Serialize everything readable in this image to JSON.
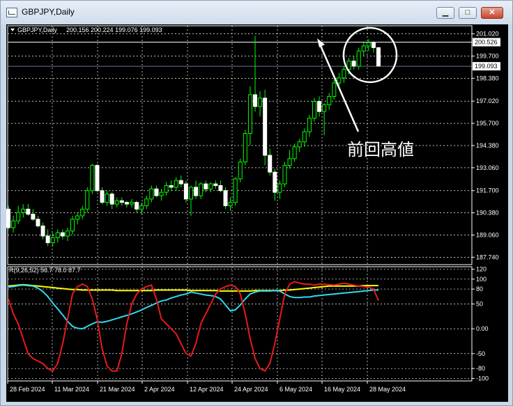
{
  "window": {
    "title": "GBPJPY,Daily",
    "minimize_label": "▁",
    "maximize_label": "□",
    "close_label": "✕"
  },
  "info_line": {
    "symbol": "GBPJPY,Daily",
    "ohlc": "200.156 200.224 199.076 199.093"
  },
  "annotation": "前回高値",
  "indicator_label": "R(9,26,52) 56.7 78.0 87.7",
  "chart_data": [
    {
      "type": "candlestick",
      "price_axis_labels": [
        "201.020",
        "199.700",
        "198.380",
        "197.020",
        "195.700",
        "194.380",
        "193.060",
        "191.700",
        "190.380",
        "189.060",
        "187.740"
      ],
      "current_price_label": "199.093",
      "marked_price_label": "200.526",
      "date_labels": [
        "28 Feb 2024",
        "11 Mar 2024",
        "21 Mar 2024",
        "2 Apr 2024",
        "12 Apr 2024",
        "24 Apr 2024",
        "6 May 2024",
        "16 May 2024",
        "28 May 2024"
      ],
      "ylim": [
        187.3,
        201.5
      ],
      "candles": [
        {
          "o": 190.6,
          "h": 190.8,
          "l": 189.4,
          "c": 189.5
        },
        {
          "o": 189.5,
          "h": 190.2,
          "l": 189.2,
          "c": 189.9
        },
        {
          "o": 189.9,
          "h": 190.8,
          "l": 189.7,
          "c": 190.4
        },
        {
          "o": 190.4,
          "h": 190.9,
          "l": 190.1,
          "c": 190.6
        },
        {
          "o": 190.6,
          "h": 190.9,
          "l": 190.2,
          "c": 190.3
        },
        {
          "o": 190.3,
          "h": 190.6,
          "l": 189.9,
          "c": 190.0
        },
        {
          "o": 190.0,
          "h": 190.2,
          "l": 189.5,
          "c": 189.6
        },
        {
          "o": 189.6,
          "h": 189.8,
          "l": 188.8,
          "c": 189.0
        },
        {
          "o": 189.0,
          "h": 189.4,
          "l": 188.4,
          "c": 188.6
        },
        {
          "o": 188.6,
          "h": 189.2,
          "l": 188.4,
          "c": 188.9
        },
        {
          "o": 188.9,
          "h": 189.4,
          "l": 188.6,
          "c": 189.2
        },
        {
          "o": 189.2,
          "h": 189.4,
          "l": 188.8,
          "c": 189.0
        },
        {
          "o": 189.0,
          "h": 189.5,
          "l": 188.7,
          "c": 189.3
        },
        {
          "o": 189.3,
          "h": 190.2,
          "l": 189.1,
          "c": 190.0
        },
        {
          "o": 190.0,
          "h": 190.4,
          "l": 189.7,
          "c": 190.2
        },
        {
          "o": 190.2,
          "h": 190.8,
          "l": 190.0,
          "c": 190.6
        },
        {
          "o": 190.6,
          "h": 191.9,
          "l": 190.4,
          "c": 191.7
        },
        {
          "o": 191.7,
          "h": 193.3,
          "l": 191.5,
          "c": 193.2
        },
        {
          "o": 193.2,
          "h": 193.3,
          "l": 191.6,
          "c": 191.7
        },
        {
          "o": 191.7,
          "h": 191.9,
          "l": 190.9,
          "c": 191.0
        },
        {
          "o": 191.0,
          "h": 191.7,
          "l": 190.8,
          "c": 191.5
        },
        {
          "o": 191.5,
          "h": 191.6,
          "l": 190.6,
          "c": 190.9
        },
        {
          "o": 190.9,
          "h": 191.3,
          "l": 190.7,
          "c": 191.1
        },
        {
          "o": 191.1,
          "h": 191.3,
          "l": 190.8,
          "c": 191.0
        },
        {
          "o": 191.0,
          "h": 191.1,
          "l": 190.7,
          "c": 190.9
        },
        {
          "o": 190.9,
          "h": 191.2,
          "l": 190.7,
          "c": 191.0
        },
        {
          "o": 191.0,
          "h": 191.1,
          "l": 190.4,
          "c": 190.6
        },
        {
          "o": 190.6,
          "h": 191.0,
          "l": 190.3,
          "c": 190.8
        },
        {
          "o": 190.8,
          "h": 191.4,
          "l": 190.6,
          "c": 191.2
        },
        {
          "o": 191.2,
          "h": 192.0,
          "l": 191.0,
          "c": 191.8
        },
        {
          "o": 191.8,
          "h": 192.0,
          "l": 191.3,
          "c": 191.4
        },
        {
          "o": 191.4,
          "h": 191.8,
          "l": 191.1,
          "c": 191.6
        },
        {
          "o": 191.6,
          "h": 192.2,
          "l": 191.4,
          "c": 192.0
        },
        {
          "o": 192.0,
          "h": 192.3,
          "l": 191.7,
          "c": 191.9
        },
        {
          "o": 191.9,
          "h": 192.5,
          "l": 191.7,
          "c": 192.3
        },
        {
          "o": 192.3,
          "h": 192.6,
          "l": 191.9,
          "c": 192.1
        },
        {
          "o": 192.1,
          "h": 192.3,
          "l": 191.0,
          "c": 191.2
        },
        {
          "o": 191.2,
          "h": 192.0,
          "l": 190.2,
          "c": 191.9
        },
        {
          "o": 191.9,
          "h": 192.3,
          "l": 191.2,
          "c": 191.4
        },
        {
          "o": 191.4,
          "h": 192.2,
          "l": 191.2,
          "c": 192.1
        },
        {
          "o": 192.1,
          "h": 192.3,
          "l": 191.6,
          "c": 191.8
        },
        {
          "o": 191.8,
          "h": 192.2,
          "l": 191.6,
          "c": 192.1
        },
        {
          "o": 192.1,
          "h": 192.3,
          "l": 191.8,
          "c": 192.0
        },
        {
          "o": 192.0,
          "h": 192.3,
          "l": 191.6,
          "c": 191.7
        },
        {
          "o": 191.7,
          "h": 191.9,
          "l": 190.6,
          "c": 190.8
        },
        {
          "o": 190.8,
          "h": 191.3,
          "l": 190.5,
          "c": 191.0
        },
        {
          "o": 191.0,
          "h": 192.5,
          "l": 190.8,
          "c": 192.4
        },
        {
          "o": 192.4,
          "h": 193.6,
          "l": 192.2,
          "c": 193.4
        },
        {
          "o": 193.4,
          "h": 195.3,
          "l": 193.2,
          "c": 195.1
        },
        {
          "o": 195.1,
          "h": 197.9,
          "l": 194.4,
          "c": 197.4
        },
        {
          "o": 197.4,
          "h": 200.9,
          "l": 196.4,
          "c": 196.7
        },
        {
          "o": 196.7,
          "h": 197.6,
          "l": 196.1,
          "c": 197.2
        },
        {
          "o": 197.2,
          "h": 197.7,
          "l": 193.2,
          "c": 193.8
        },
        {
          "o": 193.8,
          "h": 194.2,
          "l": 192.6,
          "c": 192.8
        },
        {
          "o": 192.8,
          "h": 193.0,
          "l": 191.1,
          "c": 191.6
        },
        {
          "o": 191.6,
          "h": 192.3,
          "l": 191.2,
          "c": 192.1
        },
        {
          "o": 192.1,
          "h": 193.4,
          "l": 191.9,
          "c": 193.2
        },
        {
          "o": 193.2,
          "h": 194.1,
          "l": 193.0,
          "c": 193.6
        },
        {
          "o": 193.6,
          "h": 194.5,
          "l": 193.4,
          "c": 194.3
        },
        {
          "o": 194.3,
          "h": 194.8,
          "l": 194.0,
          "c": 194.6
        },
        {
          "o": 194.6,
          "h": 195.4,
          "l": 194.3,
          "c": 195.2
        },
        {
          "o": 195.2,
          "h": 196.2,
          "l": 194.9,
          "c": 196.0
        },
        {
          "o": 196.0,
          "h": 197.2,
          "l": 195.8,
          "c": 197.0
        },
        {
          "o": 197.0,
          "h": 197.3,
          "l": 196.1,
          "c": 196.4
        },
        {
          "o": 196.4,
          "h": 196.9,
          "l": 195.0,
          "c": 196.8
        },
        {
          "o": 196.8,
          "h": 197.5,
          "l": 196.5,
          "c": 197.3
        },
        {
          "o": 197.3,
          "h": 198.3,
          "l": 197.1,
          "c": 198.1
        },
        {
          "o": 198.1,
          "h": 198.7,
          "l": 197.8,
          "c": 198.4
        },
        {
          "o": 198.4,
          "h": 199.1,
          "l": 198.1,
          "c": 198.9
        },
        {
          "o": 198.9,
          "h": 199.6,
          "l": 198.6,
          "c": 199.4
        },
        {
          "o": 199.4,
          "h": 199.7,
          "l": 198.9,
          "c": 199.1
        },
        {
          "o": 199.1,
          "h": 200.2,
          "l": 198.9,
          "c": 200.0
        },
        {
          "o": 200.0,
          "h": 200.5,
          "l": 199.7,
          "c": 200.3
        },
        {
          "o": 200.3,
          "h": 200.7,
          "l": 200.0,
          "c": 200.5
        },
        {
          "o": 200.5,
          "h": 200.6,
          "l": 199.9,
          "c": 200.2
        },
        {
          "o": 200.2,
          "h": 200.2,
          "l": 199.1,
          "c": 199.1
        }
      ]
    },
    {
      "type": "line",
      "axis_labels": [
        "120",
        "100",
        "80",
        "50",
        "0.00",
        "-50",
        "-80",
        "-100"
      ],
      "ylim": [
        -105,
        125
      ],
      "series": [
        {
          "color": "#ffff00",
          "values": [
            86,
            87,
            88,
            89,
            88,
            87,
            86,
            85,
            84,
            83,
            82,
            81,
            80,
            79,
            79,
            78,
            78,
            78,
            78,
            78,
            78,
            78,
            77,
            77,
            77,
            77,
            77,
            77,
            77,
            77,
            78,
            78,
            78,
            78,
            78,
            78,
            78,
            77,
            77,
            77,
            77,
            77,
            77,
            76,
            76,
            76,
            76,
            76,
            76,
            76,
            77,
            77,
            77,
            77,
            77,
            77,
            78,
            78,
            79,
            80,
            81,
            82,
            83,
            84,
            85,
            86,
            86,
            86,
            86,
            86,
            86,
            86,
            87,
            87,
            87,
            87
          ]
        },
        {
          "color": "#33d8f0",
          "values": [
            84,
            85,
            87,
            88,
            87,
            86,
            82,
            75,
            65,
            52,
            40,
            28,
            15,
            5,
            1,
            0,
            5,
            10,
            14,
            13,
            15,
            18,
            21,
            24,
            27,
            30,
            34,
            38,
            43,
            47,
            52,
            56,
            58,
            62,
            65,
            68,
            70,
            74,
            72,
            70,
            68,
            67,
            65,
            60,
            48,
            36,
            38,
            48,
            60,
            70,
            74,
            76,
            76,
            76,
            77,
            76,
            70,
            65,
            63,
            63,
            64,
            64,
            66,
            67,
            68,
            69,
            70,
            71,
            72,
            73,
            74,
            75,
            76,
            77,
            78,
            78
          ]
        },
        {
          "color": "#e81a1a",
          "values": [
            60,
            30,
            10,
            -20,
            -50,
            -60,
            -65,
            -70,
            -80,
            -85,
            -70,
            -30,
            20,
            70,
            85,
            90,
            85,
            60,
            20,
            -40,
            -75,
            -85,
            -85,
            -50,
            10,
            50,
            70,
            80,
            85,
            88,
            60,
            20,
            10,
            0,
            -10,
            -30,
            -50,
            -55,
            -30,
            10,
            30,
            50,
            70,
            80,
            85,
            88,
            85,
            70,
            30,
            -20,
            -60,
            -80,
            -85,
            -70,
            -30,
            20,
            70,
            90,
            95,
            92,
            90,
            90,
            88,
            90,
            90,
            89,
            88,
            90,
            92,
            90,
            88,
            86,
            85,
            84,
            80,
            56.7
          ]
        }
      ]
    }
  ]
}
